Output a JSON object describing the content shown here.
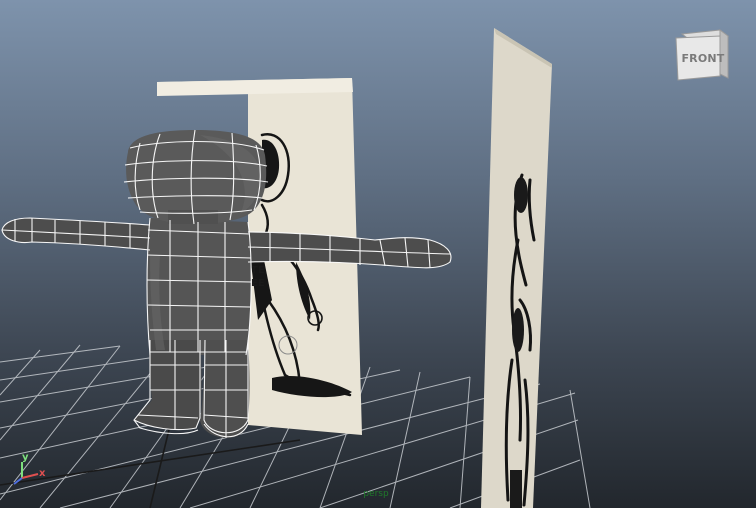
{
  "viewcube": {
    "face_label": "FRONT"
  },
  "camera": {
    "name": "persp"
  },
  "axes": {
    "y": "y",
    "x": "x"
  },
  "colors": {
    "grid": "#c8ccd0",
    "wireframe": "#ffffff",
    "mesh": "#545454",
    "paper": "#ebe6d8",
    "axis_x": "#e05050",
    "axis_y": "#7ee07e",
    "axis_z": "#4f6fe0"
  }
}
